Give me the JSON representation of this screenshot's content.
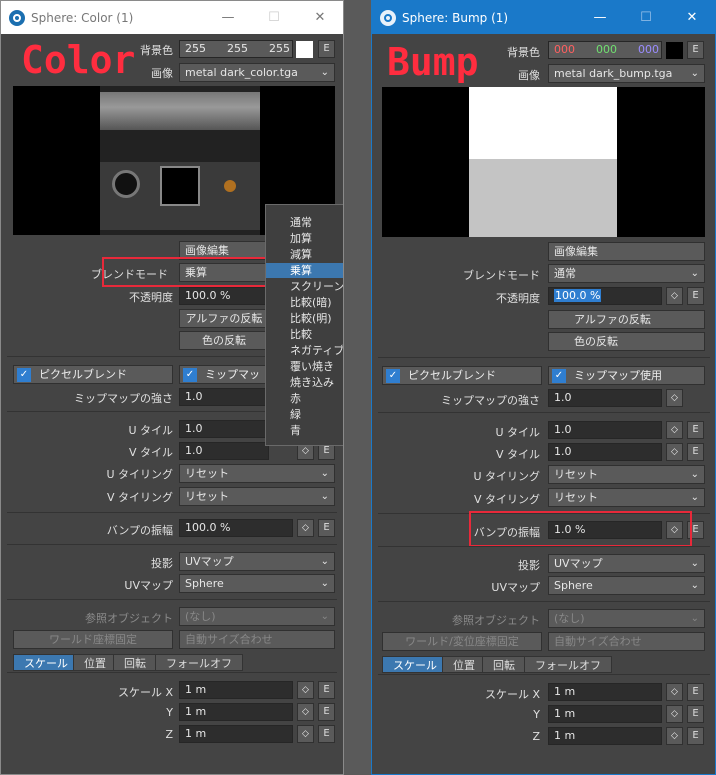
{
  "left": {
    "title": "Sphere: Color (1)",
    "overlay_label": "Color",
    "bg_label": "背景色",
    "bg": [
      "255",
      "255",
      "255"
    ],
    "bg_e": "E",
    "image_label": "画像",
    "image": "metal dark_color.tga",
    "edit_image": "画像編集",
    "blend_label": "ブレンドモード",
    "blend": "乗算",
    "opacity_label": "不透明度",
    "opacity": "100.0 %",
    "alpha_invert": "アルファの反転",
    "color_invert": "色の反転",
    "pixel_blend": "ピクセルブレンド",
    "mipmap_use": "ミップマップ使用",
    "mip_strength_label": "ミップマップの強さ",
    "mip_strength": "1.0",
    "u_tile_label": "U タイル",
    "u_tile": "1.0",
    "v_tile_label": "V タイル",
    "v_tile": "1.0",
    "u_tiling_label": "U タイリング",
    "u_tiling": "リセット",
    "v_tiling_label": "V タイリング",
    "v_tiling": "リセット",
    "bump_label": "バンプの振幅",
    "bump": "100.0 %",
    "proj_label": "投影",
    "proj": "UVマップ",
    "uvmap_label": "UVマップ",
    "uvmap": "Sphere",
    "ref_label": "参照オブジェクト",
    "ref": "(なし)",
    "world": "ワールド座標固定",
    "auto": "自動サイズ合わせ",
    "tabs": [
      "スケール",
      "位置",
      "回転",
      "フォールオフ"
    ],
    "sx_label": "スケール X",
    "sx": "1 m",
    "sy_label": "Y",
    "sy": "1 m",
    "sz_label": "Z",
    "sz": "1 m",
    "menu": [
      "通常",
      "加算",
      "減算",
      "乗算",
      "スクリーン",
      "比較(暗)",
      "比較(明)",
      "比較",
      "ネガティブ",
      "覆い焼き",
      "焼き込み",
      "赤",
      "緑",
      "青"
    ],
    "menu_selected": 3
  },
  "right": {
    "title": "Sphere: Bump (1)",
    "overlay_label": "Bump",
    "bg_label": "背景色",
    "bg": [
      "000",
      "000",
      "000"
    ],
    "bg_e": "E",
    "image_label": "画像",
    "image": "metal dark_bump.tga",
    "edit_image": "画像編集",
    "blend_label": "ブレンドモード",
    "blend": "通常",
    "opacity_label": "不透明度",
    "opacity": "100.0 %",
    "alpha_invert": "アルファの反転",
    "color_invert": "色の反転",
    "pixel_blend": "ピクセルブレンド",
    "mipmap_use": "ミップマップ使用",
    "mip_strength_label": "ミップマップの強さ",
    "mip_strength": "1.0",
    "u_tile_label": "U タイル",
    "u_tile": "1.0",
    "v_tile_label": "V タイル",
    "v_tile": "1.0",
    "u_tiling_label": "U タイリング",
    "u_tiling": "リセット",
    "v_tiling_label": "V タイリング",
    "v_tiling": "リセット",
    "bump_label": "バンプの振幅",
    "bump": "1.0 %",
    "proj_label": "投影",
    "proj": "UVマップ",
    "uvmap_label": "UVマップ",
    "uvmap": "Sphere",
    "ref_label": "参照オブジェクト",
    "ref": "(なし)",
    "world": "ワールド/変位座標固定",
    "auto": "自動サイズ合わせ",
    "tabs": [
      "スケール",
      "位置",
      "回転",
      "フォールオフ"
    ],
    "sx_label": "スケール X",
    "sx": "1 m",
    "sy_label": "Y",
    "sy": "1 m",
    "sz_label": "Z",
    "sz": "1 m"
  },
  "icons": {
    "minimize": "—",
    "maximize": "☐",
    "close": "✕",
    "chevron": "❯",
    "arrows": "◇",
    "check": "✓"
  },
  "colors": {
    "highlight": "#e8293a",
    "accent": "#1a79c9",
    "selection": "#3c78b0"
  }
}
